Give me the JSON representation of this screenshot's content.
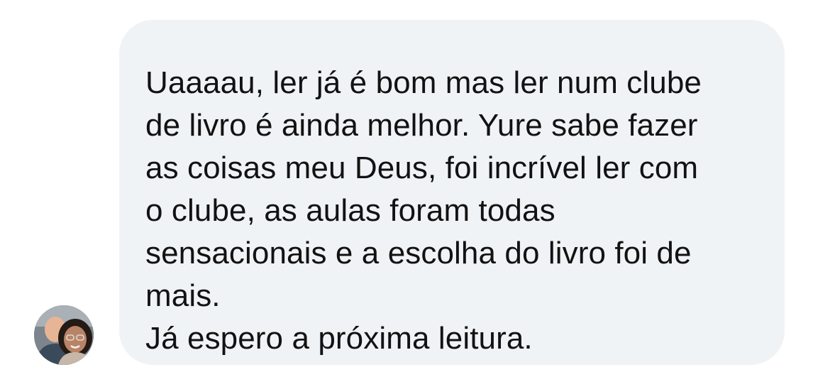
{
  "message": {
    "lines": [
      "Uaaaau, ler já é bom mas ler num clube",
      "de livro é ainda melhor. Yure sabe fazer",
      "as coisas meu Deus, foi incrível ler com",
      "o clube, as aulas foram todas",
      "sensacionais e a escolha do livro foi de",
      "mais.",
      "Já espero a próxima leitura."
    ],
    "bubble_color": "#f0f3f5",
    "text_color": "#121212"
  },
  "sender": {
    "avatar_icon": "profile-photo-avatar"
  }
}
